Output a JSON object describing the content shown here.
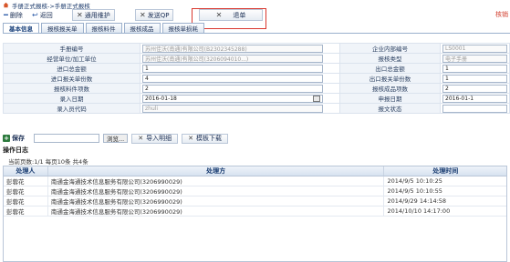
{
  "breadcrumb": {
    "text": "手册正式报核->手册正式报核"
  },
  "toolbar": {
    "delete_label": "删除",
    "back_label": "返回",
    "general_maint_label": "通用维护",
    "send_qp_label": "发送QP",
    "withdraw_label": "退单",
    "check_label": "核销"
  },
  "tabs": [
    "基本信息",
    "报核报关单",
    "报核料件",
    "报核成品",
    "报核单损耗"
  ],
  "form": {
    "rows": [
      {
        "l1": "手册编号",
        "v1": "",
        "l2": "企业内部编号",
        "v2": "LS0001"
      },
      {
        "l1": "经营单位/加工单位",
        "v1": "苏州佳沃(南通)有限公司(3206...)",
        "l2": "报核类型",
        "v2": "电子手册"
      },
      {
        "l1": "进口总金额",
        "v1": "1",
        "l2": "出口总金额",
        "v2": "1"
      },
      {
        "l1": "进口报关单份数",
        "v1": "4",
        "l2": "出口报关单份数",
        "v2": "1"
      },
      {
        "l1": "报核料件项数",
        "v1": "2",
        "l2": "报核成品项数",
        "v2": "2"
      },
      {
        "l1": "录入日期",
        "v1": "2016-01-18",
        "l2": "申报日期",
        "v2": "2016-01-1"
      },
      {
        "l1": "录入员代码",
        "v1": "zhuli",
        "l2": "报文状态",
        "v2": ""
      }
    ],
    "handbook_no_value": "苏州佳沃(南通)有限公司(B2302345288)",
    "operator_value": "苏州佳沃(南通)有限公司(3206094010...)"
  },
  "actions": {
    "save_label": "保存",
    "browse_label": "浏览...",
    "import_label": "导入明细",
    "template_label": "模板下载"
  },
  "log": {
    "title": "操作日志",
    "pager": "当前页数:1/1  每页10条  共4条",
    "headers": [
      "处理人",
      "处理方",
      "处理时间"
    ],
    "rows": [
      [
        "彭蓉花",
        "南通金海通技术信息服务有限公司(3206990029)",
        "2014/9/5 10:10:25"
      ],
      [
        "彭蓉花",
        "南通金海通技术信息服务有限公司(3206990029)",
        "2014/9/5 10:10:55"
      ],
      [
        "彭蓉花",
        "南通金海通技术信息服务有限公司(3206990029)",
        "2014/9/29 14:14:58"
      ],
      [
        "彭蓉花",
        "南通金海通技术信息服务有限公司(3206990029)",
        "2014/10/10 14:17:00"
      ]
    ]
  }
}
